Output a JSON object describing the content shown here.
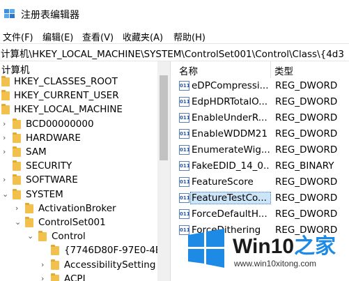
{
  "window": {
    "title": "注册表编辑器"
  },
  "menu": [
    "文件(F)",
    "编辑(E)",
    "查看(V)",
    "收藏夹(A)",
    "帮助(H)"
  ],
  "address": "计算机\\HKEY_LOCAL_MACHINE\\SYSTEM\\ControlSet001\\Control\\Class\\{4d3",
  "tree": {
    "root": "计算机",
    "nodes": [
      {
        "label": "HKEY_CLASSES_ROOT"
      },
      {
        "label": "HKEY_CURRENT_USER"
      },
      {
        "label": "HKEY_LOCAL_MACHINE"
      },
      {
        "label": "BCD00000000"
      },
      {
        "label": "HARDWARE"
      },
      {
        "label": "SAM"
      },
      {
        "label": "SECURITY"
      },
      {
        "label": "SOFTWARE"
      },
      {
        "label": "SYSTEM"
      },
      {
        "label": "ActivationBroker"
      },
      {
        "label": "ControlSet001"
      },
      {
        "label": "Control"
      },
      {
        "label": "{7746D80F-97E0-4E"
      },
      {
        "label": "AccessibilitySetting"
      },
      {
        "label": "ACPI"
      }
    ]
  },
  "list": {
    "columns": {
      "name": "名称",
      "type": "类型"
    },
    "rows": [
      {
        "name": "eDPCompressi...",
        "type": "REG_DWORD"
      },
      {
        "name": "EdpHDRTotalO...",
        "type": "REG_DWORD"
      },
      {
        "name": "EnableUnderR...",
        "type": "REG_DWORD"
      },
      {
        "name": "EnableWDDM21",
        "type": "REG_DWORD"
      },
      {
        "name": "EnumerateWig...",
        "type": "REG_DWORD"
      },
      {
        "name": "FakeEDID_14_0...",
        "type": "REG_BINARY"
      },
      {
        "name": "FeatureScore",
        "type": "REG_DWORD"
      },
      {
        "name": "FeatureTestCo...",
        "type": "REG_DWORD"
      },
      {
        "name": "ForceDefaultH...",
        "type": "REG_DWORD"
      },
      {
        "name": "ForceDithering",
        "type": "REG_DWORD"
      }
    ],
    "selected_index": 7
  },
  "watermark": {
    "brand": "Win10",
    "brand_suffix": "之家",
    "url": "www.win10xitong.com"
  },
  "colors": {
    "accent": "#1d8ae6",
    "folder": "#f2c04c",
    "selection": "#cce4f7"
  }
}
